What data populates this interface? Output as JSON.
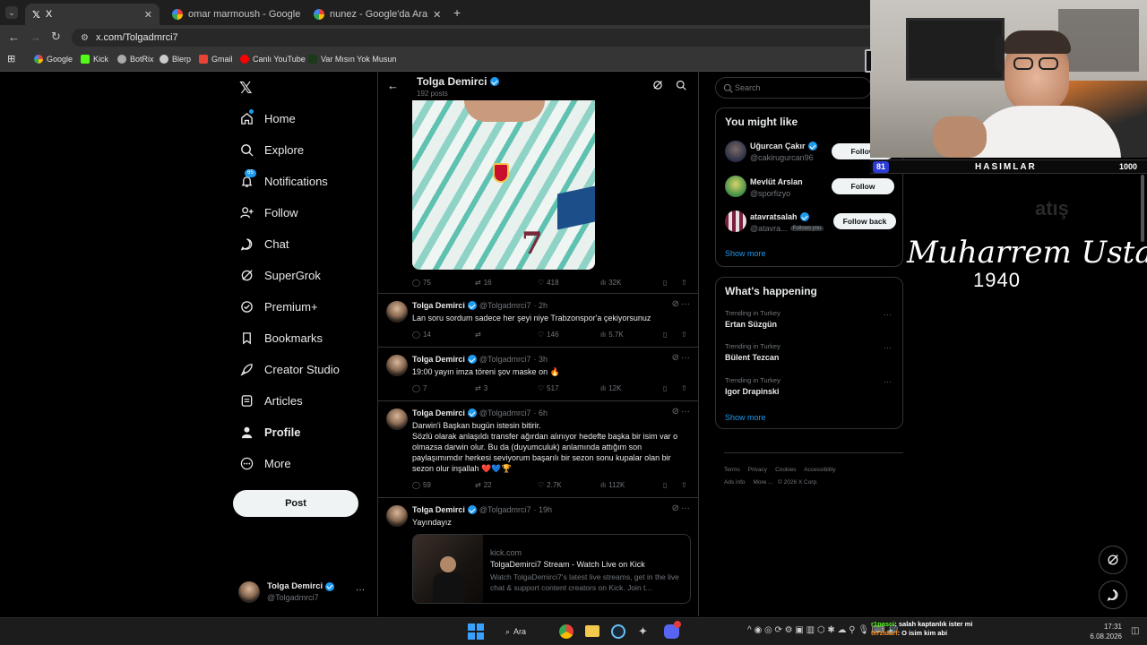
{
  "browser": {
    "tabs": [
      {
        "title": "X",
        "active": true
      },
      {
        "title": "omar marmoush - Google'da Ar",
        "active": false
      },
      {
        "title": "nunez - Google'da Ara",
        "active": false
      }
    ],
    "url": "x.com/Tolgadmrci7",
    "bookmarks": [
      "Google",
      "Kick",
      "BotRix",
      "Blerp",
      "Gmail",
      "Canlı YouTube",
      "Var Mısın Yok Musun"
    ]
  },
  "sidebar": {
    "items": [
      {
        "label": "Home",
        "icon": "home-icon"
      },
      {
        "label": "Explore",
        "icon": "search-icon"
      },
      {
        "label": "Notifications",
        "icon": "bell-icon",
        "badge": "65"
      },
      {
        "label": "Follow",
        "icon": "add-person-icon"
      },
      {
        "label": "Chat",
        "icon": "chat-icon"
      },
      {
        "label": "SuperGrok",
        "icon": "grok-icon"
      },
      {
        "label": "Premium+",
        "icon": "premium-icon"
      },
      {
        "label": "Bookmarks",
        "icon": "bookmark-icon"
      },
      {
        "label": "Creator Studio",
        "icon": "rocket-icon"
      },
      {
        "label": "Articles",
        "icon": "article-icon"
      },
      {
        "label": "Profile",
        "icon": "person-icon"
      },
      {
        "label": "More",
        "icon": "more-circle-icon"
      }
    ],
    "post_label": "Post",
    "account": {
      "name": "Tolga Demirci",
      "handle": "@Tolgadmrci7"
    }
  },
  "profile_header": {
    "name": "Tolga Demirci",
    "posts": "192 posts"
  },
  "tweets": [
    {
      "replies": "75",
      "reposts": "16",
      "likes": "418",
      "views": "32K"
    },
    {
      "name": "Tolga Demirci",
      "handle": "@Tolgadmrci7",
      "time": "· 2h",
      "text": "Lan soru sordum sadece her şeyi niye Trabzonspor'a çekiyorsunuz",
      "replies": "14",
      "reposts": "",
      "likes": "146",
      "views": "5.7K"
    },
    {
      "name": "Tolga Demirci",
      "handle": "@Tolgadmrci7",
      "time": "· 3h",
      "text": "19:00 yayın imza töreni şov maske on 🔥",
      "replies": "7",
      "reposts": "3",
      "likes": "517",
      "views": "12K"
    },
    {
      "name": "Tolga Demirci",
      "handle": "@Tolgadmrci7",
      "time": "· 6h",
      "text": "Darwin'i Başkan bugün istesin bitirir.\nSözlü olarak anlaşıldı transfer ağırdan alınıyor hedefte başka bir isim var o olmazsa darwin olur. Bu da (duyumculuk) anlamında attığım son paylaşımımdır herkesi seviyorum başarılı bir sezon sonu kupalar olan bir sezon olur inşallah ❤️💙🏆",
      "replies": "59",
      "reposts": "22",
      "likes": "2.7K",
      "views": "112K"
    },
    {
      "name": "Tolga Demirci",
      "handle": "@Tolgadmrci7",
      "time": "· 19h",
      "text": "Yayındayız",
      "link_card": {
        "domain": "kick.com",
        "title": "TolgaDemirci7 Stream - Watch Live on Kick",
        "desc": "Watch TolgaDemirci7's latest live streams, get in the live chat & support content creators on Kick. Join t..."
      }
    }
  ],
  "right": {
    "search_placeholder": "Search",
    "might_like_title": "You might like",
    "suggestions": [
      {
        "name": "Uğurcan Çakır",
        "handle": "@cakirugurcan96",
        "button": "Follow",
        "verified": true
      },
      {
        "name": "Mevlüt Arslan",
        "handle": "@sporfizyo",
        "button": "Follow",
        "verified": false
      },
      {
        "name": "atavratsalah",
        "handle": "@atavra...",
        "button": "Follow back",
        "verified": true,
        "follows_you": "Follows you"
      }
    ],
    "show_more": "Show more",
    "happening_title": "What's happening",
    "trends": [
      {
        "meta": "Trending in Turkey",
        "name": "Ertan Süzgün"
      },
      {
        "meta": "Trending in Turkey",
        "name": "Bülent Tezcan"
      },
      {
        "meta": "Trending in Turkey",
        "name": "Igor Drapinski"
      }
    ],
    "footer": [
      "Terms",
      "Privacy",
      "Cookies",
      "Accessibility",
      "Ads info",
      "More ...",
      "© 2026 X Corp."
    ]
  },
  "overlay": {
    "hud_left": "81",
    "hud_title": "HASIMLAR",
    "hud_right": "1000",
    "caption_name": "Muharrem Usta",
    "caption_year": "1940",
    "faded_text": "atış"
  },
  "taskbar": {
    "search": "Ara",
    "chat_lines": [
      {
        "user": "r1pasci",
        "msg": ": salah kaptanlık ister mi"
      },
      {
        "user": "terzidarf",
        "msg": ": O isim kim abi"
      }
    ],
    "time": "17:31",
    "date": "6.08.2026"
  },
  "colors": {
    "accent": "#1d9bf0",
    "like_red": "#f91880",
    "kick_green": "#53fc18"
  }
}
